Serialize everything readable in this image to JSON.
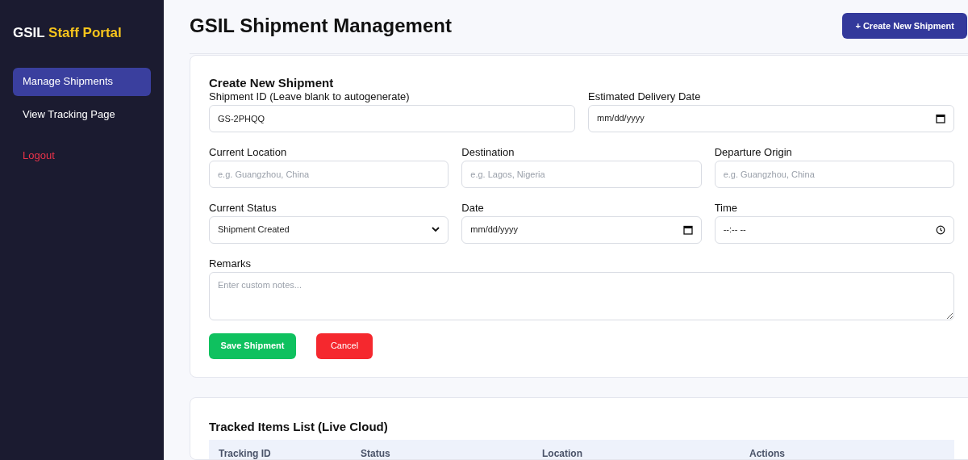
{
  "sidebar": {
    "brand": {
      "first": "GSIL",
      "second": "Staff Portal"
    },
    "items": [
      {
        "label": "Manage Shipments",
        "selected": true,
        "kind": "nav"
      },
      {
        "label": "View Tracking Page",
        "selected": false,
        "kind": "nav"
      },
      {
        "label": "Logout",
        "selected": false,
        "kind": "logout"
      }
    ]
  },
  "header": {
    "title": "GSIL Shipment Management",
    "button": "+ Create New Shipment"
  },
  "form": {
    "title": "Create New Shipment",
    "rows": [
      [
        {
          "label": "Shipment ID (Leave blank to autogenerate)",
          "kind": "text",
          "value": "GS-2PHQQ"
        },
        {
          "label": "Estimated Delivery Date",
          "kind": "date",
          "value": "mm/dd/yyyy"
        }
      ],
      [
        {
          "label": "Current Location",
          "kind": "text",
          "placeholder": "e.g. Guangzhou, China"
        },
        {
          "label": "Destination",
          "kind": "text",
          "placeholder": "e.g. Lagos, Nigeria"
        },
        {
          "label": "Departure Origin",
          "kind": "text",
          "placeholder": "e.g. Guangzhou, China"
        }
      ],
      [
        {
          "label": "Current Status",
          "kind": "select",
          "value": "Shipment Created"
        },
        {
          "label": "Date",
          "kind": "date",
          "value": "mm/dd/yyyy"
        },
        {
          "label": "Time",
          "kind": "time",
          "value": "--:-- --"
        }
      ]
    ],
    "remarks": {
      "label": "Remarks",
      "placeholder": "Enter custom notes..."
    },
    "save": "Save Shipment",
    "cancel": "Cancel"
  },
  "table": {
    "title": "Tracked Items List (Live Cloud)",
    "columns": [
      "Tracking ID",
      "Status",
      "Location",
      "Actions"
    ]
  }
}
